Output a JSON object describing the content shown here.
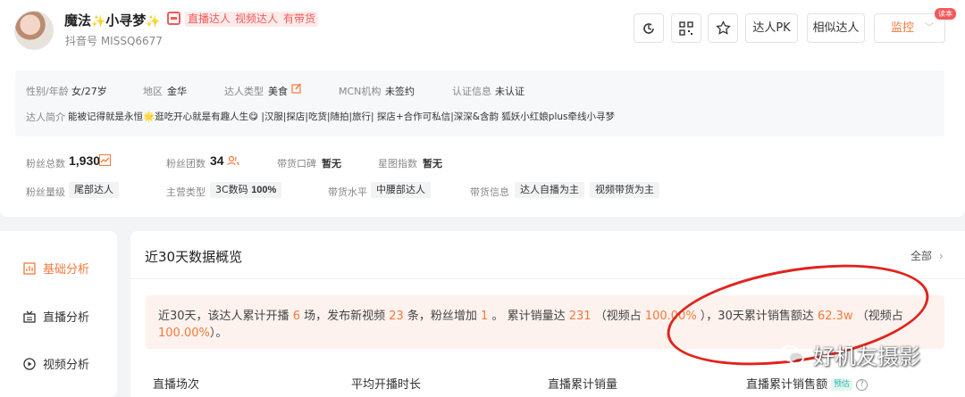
{
  "profile": {
    "name_part1": "魔法",
    "name_part2": "小寻梦",
    "spark_glyph": "✨",
    "tags": [
      "直播达人",
      "视频达人",
      "有带货"
    ],
    "douyin_id": "抖音号 MISSQ6677"
  },
  "header_actions": {
    "pk_label": "达人PK",
    "similar_label": "相似达人",
    "monitor_label": "监控",
    "corner_badge": "读本"
  },
  "info": {
    "gender_age_label": "性别/年龄",
    "gender_age_value": "女/27岁",
    "region_label": "地区",
    "region_value": "金华",
    "type_label": "达人类型",
    "type_value": "美食",
    "mcn_label": "MCN机构",
    "mcn_value": "未签约",
    "cert_label": "认证信息",
    "cert_value": "未认证",
    "bio_label": "达人简介",
    "bio_value": "能被记得就是永恒🌟逛吃开心就是有趣人生😋 |汉服|探店|吃货|随拍|旅行|  探店+合作可私信|深深&含韵 狐妖小红娘plus牵线小寻梦"
  },
  "stats": {
    "fans_total_label": "粉丝总数",
    "fans_total_value": "1,930",
    "fan_group_label": "粉丝团数",
    "fan_group_value": "34",
    "reputation_label": "带货口碑",
    "reputation_value": "暂无",
    "star_index_label": "星图指数",
    "star_index_value": "暂无",
    "fan_level_label": "粉丝量级",
    "fan_level_value": "尾部达人",
    "main_type_label": "主营类型",
    "main_type_value": "3C数码",
    "main_type_pct": "100%",
    "sales_level_label": "带货水平",
    "sales_level_value": "中腰部达人",
    "sales_info_label": "带货信息",
    "sales_info_tags": [
      "达人自播为主",
      "视频带货为主"
    ]
  },
  "side_nav": {
    "items": [
      {
        "label": "基础分析",
        "icon": "chart-icon"
      },
      {
        "label": "直播分析",
        "icon": "live-icon"
      },
      {
        "label": "视频分析",
        "icon": "play-icon"
      }
    ]
  },
  "overview": {
    "title": "近30天数据概览",
    "all_label": "全部",
    "summary": {
      "s1": "近30天，该达人累计开播 ",
      "live_count": "6",
      "s2": " 场，发布新视频 ",
      "video_count": "23",
      "s3": " 条，粉丝增加 ",
      "fans_added": "1",
      "s4": " 。 累计销量达 ",
      "sales": "231",
      "s5": " （视频占 ",
      "video_share1": "100.00%",
      "s6": " ），30天累计销售额达 ",
      "revenue": "62.3w",
      "s7": " （视频占 ",
      "video_share2": "100.00%",
      "s8": "）。"
    },
    "columns": {
      "c1": "直播场次",
      "c2": "平均开播时长",
      "c3": "直播累计销量",
      "c4": "直播累计销售额",
      "est_badge": "预估"
    }
  },
  "watermark": {
    "text": "好机友摄影"
  },
  "colors": {
    "accent": "#f47a3a",
    "tag_red": "#f25a5a",
    "annotation_red": "#e0231c"
  }
}
